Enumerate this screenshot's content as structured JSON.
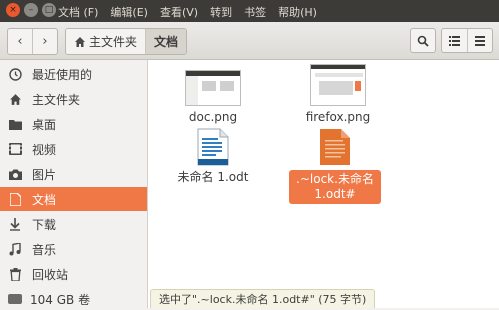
{
  "window": {
    "close_glyph": "×",
    "min_glyph": "–",
    "max_glyph": "□"
  },
  "menu": [
    "文档",
    "(F)",
    "编辑(E)",
    "查看(V)",
    "转到",
    "书签",
    "帮助(H)"
  ],
  "menu_labels": {
    "file": "文档 (F)",
    "edit": "编辑(E)",
    "view": "查看(V)",
    "go": "转到",
    "bookmarks": "书签",
    "help": "帮助(H)"
  },
  "toolbar": {
    "back_glyph": "‹",
    "forward_glyph": "›",
    "home_crumb": "主文件夹",
    "current_crumb": "文档",
    "search_icon": "search-icon",
    "list_view_icon": "list-view-icon",
    "menu_icon": "hamburger-icon"
  },
  "sidebar": {
    "items": [
      {
        "label": "最近使用的",
        "icon": "clock-icon"
      },
      {
        "label": "主文件夹",
        "icon": "home-icon"
      },
      {
        "label": "桌面",
        "icon": "folder-icon"
      },
      {
        "label": "视频",
        "icon": "video-icon"
      },
      {
        "label": "图片",
        "icon": "camera-icon"
      },
      {
        "label": "文档",
        "icon": "document-icon",
        "selected": true
      },
      {
        "label": "下载",
        "icon": "download-icon"
      },
      {
        "label": "音乐",
        "icon": "music-icon"
      },
      {
        "label": "回收站",
        "icon": "trash-icon"
      }
    ],
    "device": {
      "label": "104 GB 卷",
      "icon": "disk-icon"
    }
  },
  "files": [
    {
      "name": "doc.png",
      "type": "image"
    },
    {
      "name": "firefox.png",
      "type": "image"
    },
    {
      "name": "未命名 1.odt",
      "type": "odt"
    },
    {
      "name": ".~lock.未命名 1.odt#",
      "type": "lock",
      "selected": true
    }
  ],
  "status": {
    "text": "选中了\".~lock.未命名 1.odt#\" (75 字节)"
  },
  "colors": {
    "accent": "#f07746",
    "titlebar": "#3c3b37"
  }
}
